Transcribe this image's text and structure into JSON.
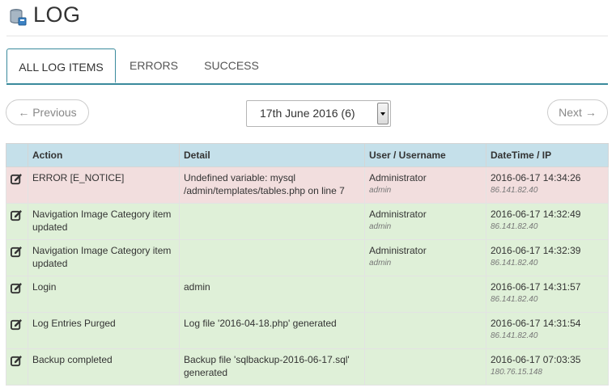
{
  "header": {
    "title": "LOG",
    "icon": "database-icon"
  },
  "tabs": [
    {
      "label": "ALL LOG ITEMS",
      "active": true
    },
    {
      "label": "ERRORS",
      "active": false
    },
    {
      "label": "SUCCESS",
      "active": false
    }
  ],
  "pagination": {
    "previous_label": "← Previous",
    "next_label": "Next →",
    "date_select_value": "17th June 2016 (6)"
  },
  "table": {
    "columns": [
      "Action",
      "Detail",
      "User / Username",
      "DateTime / IP"
    ],
    "rows": [
      {
        "status": "error",
        "action": "ERROR [E_NOTICE]",
        "detail": "Undefined variable: mysql /admin/templates/tables.php on line 7",
        "user": "Administrator",
        "username": "admin",
        "datetime": "2016-06-17 14:34:26",
        "ip": "86.141.82.40"
      },
      {
        "status": "success",
        "action": "Navigation Image Category item updated",
        "detail": "",
        "user": "Administrator",
        "username": "admin",
        "datetime": "2016-06-17 14:32:49",
        "ip": "86.141.82.40"
      },
      {
        "status": "success",
        "action": "Navigation Image Category item updated",
        "detail": "",
        "user": "Administrator",
        "username": "admin",
        "datetime": "2016-06-17 14:32:39",
        "ip": "86.141.82.40"
      },
      {
        "status": "success",
        "action": "Login",
        "detail": "admin",
        "user": "",
        "username": "",
        "datetime": "2016-06-17 14:31:57",
        "ip": "86.141.82.40"
      },
      {
        "status": "success",
        "action": "Log Entries Purged",
        "detail": "Log file '2016-04-18.php' generated",
        "user": "",
        "username": "",
        "datetime": "2016-06-17 14:31:54",
        "ip": "86.141.82.40"
      },
      {
        "status": "success",
        "action": "Backup completed",
        "detail": "Backup file 'sqlbackup-2016-06-17.sql' generated",
        "user": "",
        "username": "",
        "datetime": "2016-06-17 07:03:35",
        "ip": "180.76.15.148"
      }
    ]
  },
  "colors": {
    "error_row": "#f2dede",
    "success_row": "#dff0d8",
    "header_row": "#c5e0ea",
    "tab_accent": "#3a8a9c"
  }
}
